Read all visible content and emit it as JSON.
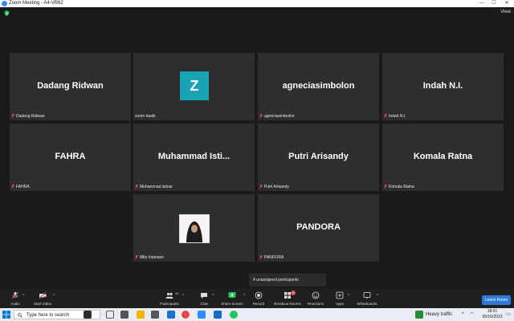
{
  "window": {
    "title": "Zoom Meeting - A4-VR62",
    "minimize": "—",
    "maximize": "☐",
    "close": "✕"
  },
  "header": {
    "view_label": "View"
  },
  "participants_grid": [
    {
      "big": "Dadang Ridwan",
      "small": "Dadang Ridwan",
      "kind": "name"
    },
    {
      "big": "Z",
      "small": "zoom baalk",
      "kind": "avatar"
    },
    {
      "big": "agneciasimbolon",
      "small": "agneciasimbolon",
      "kind": "name"
    },
    {
      "big": "Indah N.I.",
      "small": "Indah N.I.",
      "kind": "name"
    },
    {
      "big": "FAHRA",
      "small": "FAHRA",
      "kind": "name"
    },
    {
      "big": "Muhammad  Isti...",
      "small": "Muhammad istizar",
      "kind": "name"
    },
    {
      "big": "Putri Arisandy",
      "small": "Putri Arisandy",
      "kind": "name"
    },
    {
      "big": "Komala Ratna",
      "small": "Komala Ratna",
      "kind": "name"
    },
    {
      "big": "",
      "small": "Mila Intansari",
      "kind": "photo"
    },
    {
      "big": "PANDORA",
      "small": "PANDORA",
      "kind": "name"
    }
  ],
  "popup": {
    "text": "4 unassigned participants"
  },
  "toolbar": {
    "audio": "Audio",
    "start_video": "Start Video",
    "participants": "Participants",
    "participants_count": "10",
    "chat": "Chat",
    "share_screen": "Share Screen",
    "record": "Record",
    "breakout_rooms": "Breakout Rooms",
    "breakout_badge": "4",
    "reactions": "Reactions",
    "apps": "Apps",
    "whiteboards": "Whiteboards",
    "leave": "Leave Room"
  },
  "taskbar": {
    "search_placeholder": "Type here to search",
    "weather": "Heavy traffic",
    "time": "18:41",
    "date": "05/16/2023"
  },
  "colors": {
    "accent": "#2d8cff",
    "share_green": "#22c55e",
    "leave_blue": "#2d7bd6",
    "avatar_teal": "#1aa2b5",
    "mic_red": "#e5484d"
  }
}
